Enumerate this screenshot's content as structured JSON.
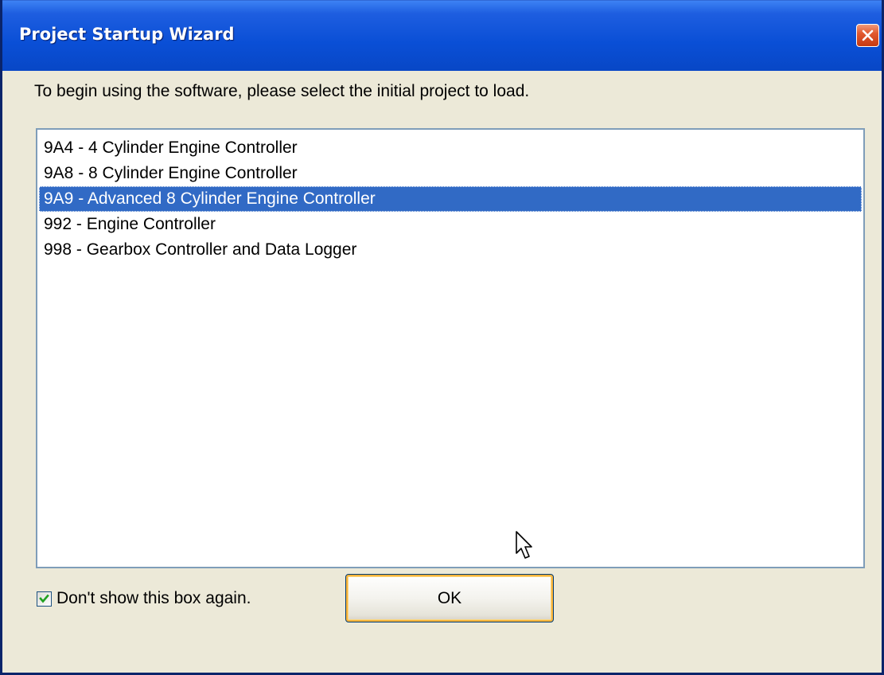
{
  "window": {
    "title": "Project Startup Wizard"
  },
  "close_button": {
    "icon": "close-icon"
  },
  "instruction": "To begin using the software, please select the initial project to load.",
  "project_list": {
    "selected_index": 2,
    "items": [
      {
        "label": "9A4 - 4 Cylinder Engine Controller"
      },
      {
        "label": "9A8 - 8 Cylinder Engine Controller"
      },
      {
        "label": "9A9 - Advanced 8 Cylinder Engine Controller"
      },
      {
        "label": "992 - Engine Controller"
      },
      {
        "label": "998 - Gearbox Controller and Data Logger"
      }
    ]
  },
  "dont_show_checkbox": {
    "label": "Don't show this box again.",
    "checked": true
  },
  "ok_button": {
    "label": "OK"
  },
  "colors": {
    "titlebar": "#0a4fd6",
    "selection": "#316ac5",
    "dialog_bg": "#ece9d8",
    "close_button": "#e2592f",
    "button_focus": "#f8b33a"
  }
}
